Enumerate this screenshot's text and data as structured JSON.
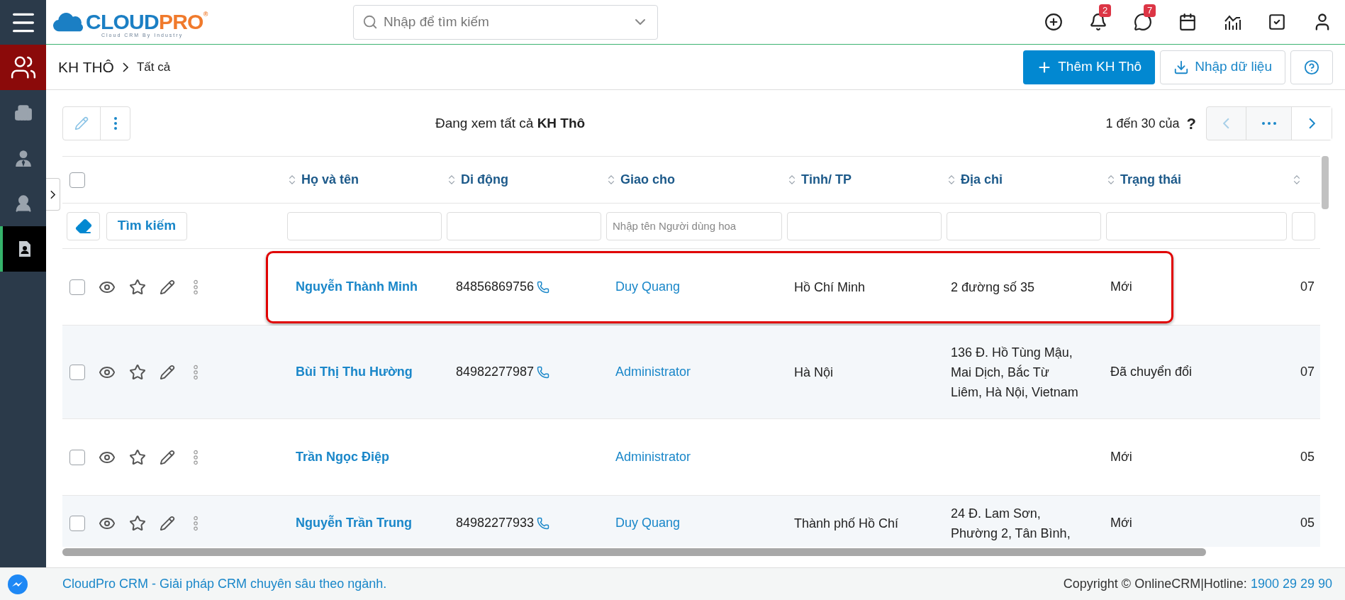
{
  "sidebar": {
    "items": [
      {
        "kind": "module",
        "selected": true
      },
      {
        "kind": "page",
        "selected": false
      },
      {
        "kind": "page",
        "selected": false
      },
      {
        "kind": "page",
        "selected": false
      },
      {
        "kind": "page",
        "selected": true
      }
    ]
  },
  "logo": {
    "word_1": "CLOUD",
    "word_2": "PRO",
    "mark": "®",
    "tagline": "Cloud CRM By Industry"
  },
  "search": {
    "placeholder": "Nhập để tìm kiếm"
  },
  "top_actions": {
    "notifications_badge": "2",
    "messages_badge": "7"
  },
  "breadcrumb": {
    "module": "KH THÔ",
    "current": "Tất cả"
  },
  "header_buttons": {
    "add": "Thêm KH Thô",
    "import": "Nhập dữ liệu"
  },
  "toolbar": {
    "view_title": "Đang xem tất cả **KH Thô**",
    "range": "1 đến 30 của",
    "total": "?",
    "prev_disabled": true
  },
  "table": {
    "select_all_checked": false,
    "search_button": "Tìm kiếm",
    "columns": [
      "Họ và tên",
      "Di động",
      "Giao cho",
      "Tỉnh/ TP",
      "Địa chỉ",
      "Trạng thái"
    ],
    "assigned_to_filter": {
      "placeholder": "Nhập tên Người dùng hoa"
    },
    "rows": [
      {
        "checked": false,
        "highlighted": true,
        "name": "Nguyễn Thành Minh",
        "mobile": "84856869756",
        "assigned_to": "Duy Quang",
        "province": "Hồ Chí Minh",
        "address": "2 đường số 35",
        "status": "Mới",
        "column_8": "07"
      },
      {
        "checked": false,
        "highlighted": false,
        "name": "Bùi Thị Thu Hường",
        "mobile": "84982277987",
        "assigned_to": "Administrator",
        "province": "Hà Nội",
        "address": "136 Đ. Hồ Tùng Mậu, Mai Dịch, Bắc Từ Liêm, Hà Nội, Vietnam",
        "status": "Đã chuyển đổi",
        "column_8": "07"
      },
      {
        "checked": false,
        "highlighted": false,
        "name": "Trần Ngọc Điệp",
        "assigned_to": "Administrator",
        "status": "Mới",
        "column_8": "05"
      },
      {
        "checked": false,
        "highlighted": false,
        "name": "Nguyễn Trần Trung",
        "mobile": "84982277933",
        "assigned_to": "Duy Quang",
        "province": "Thành phố Hồ Chí",
        "address": "24 Đ. Lam Sơn, Phường 2, Tân Bình,",
        "status": "Mới",
        "column_8": "05"
      }
    ]
  },
  "footer": {
    "slogan": "CloudPro CRM - Giải pháp CRM chuyên sâu theo ngành.",
    "copyright": "Copyright © OnlineCRM|Hotline: ",
    "hotline": "1900 29 29 90"
  }
}
